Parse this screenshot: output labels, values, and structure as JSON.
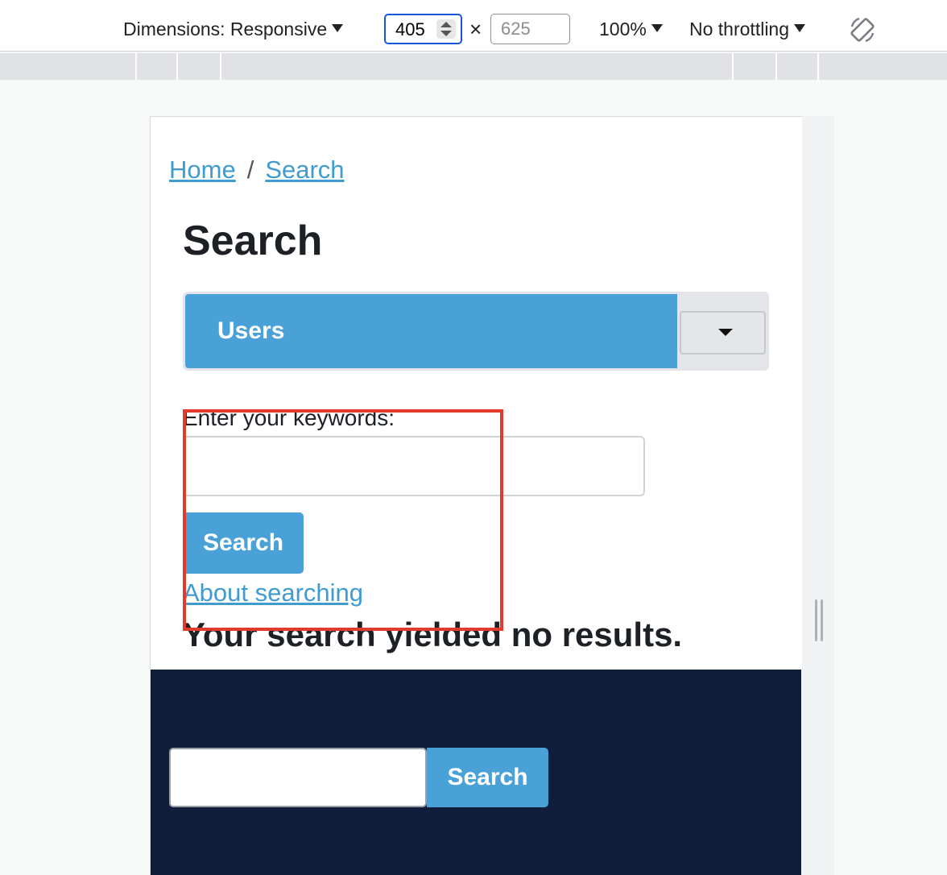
{
  "devtools": {
    "dimensions_label": "Dimensions: Responsive",
    "width_value": "405",
    "times": "×",
    "height_placeholder": "625",
    "zoom": "100%",
    "throttling": "No throttling",
    "rotate_icon": "rotate-device-icon"
  },
  "breadcrumb": {
    "home": "Home",
    "separator": "/",
    "current": "Search"
  },
  "page": {
    "title": "Search",
    "search_area_selected": "Users",
    "keywords_label": "Enter your keywords:",
    "keywords_value": "",
    "search_button": "Search",
    "about_link": "About searching",
    "no_results": "Your search yielded no results."
  },
  "footer": {
    "search_value": "",
    "search_button": "Search"
  },
  "colors": {
    "accent": "#4aa1d7",
    "footer_bg": "#101d3b",
    "annotation": "#e23a2b"
  }
}
